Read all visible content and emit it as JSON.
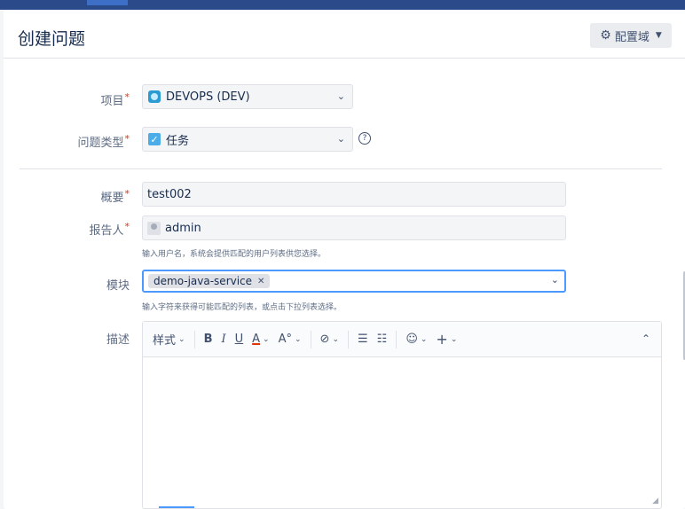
{
  "dialog": {
    "title": "创建问题",
    "config_button": "配置域"
  },
  "fields": {
    "project": {
      "label": "项目",
      "value": "DEVOPS (DEV)"
    },
    "issue_type": {
      "label": "问题类型",
      "value": "任务"
    },
    "summary": {
      "label": "概要",
      "value": "test002"
    },
    "reporter": {
      "label": "报告人",
      "value": "admin",
      "hint": "输入用户名，系统会提供匹配的用户列表供您选择。"
    },
    "component": {
      "label": "模块",
      "chip": "demo-java-service",
      "hint": "输入字符来获得可能匹配的列表，或点击下拉列表选择。"
    },
    "description": {
      "label": "描述"
    }
  },
  "required_marker": "*",
  "toolbar": {
    "style_label": "样式",
    "bold": "B",
    "italic": "I",
    "underline": "U",
    "text_color": "A",
    "more_format": "A°",
    "link": "⊘",
    "bullet_list": "☰",
    "numbered_list": "☷",
    "emoji": "☺",
    "insert": "+",
    "collapse": "⌃"
  },
  "colors": {
    "accent": "#4c9aff",
    "required": "#de350b",
    "topbar": "#2a4a8a"
  }
}
